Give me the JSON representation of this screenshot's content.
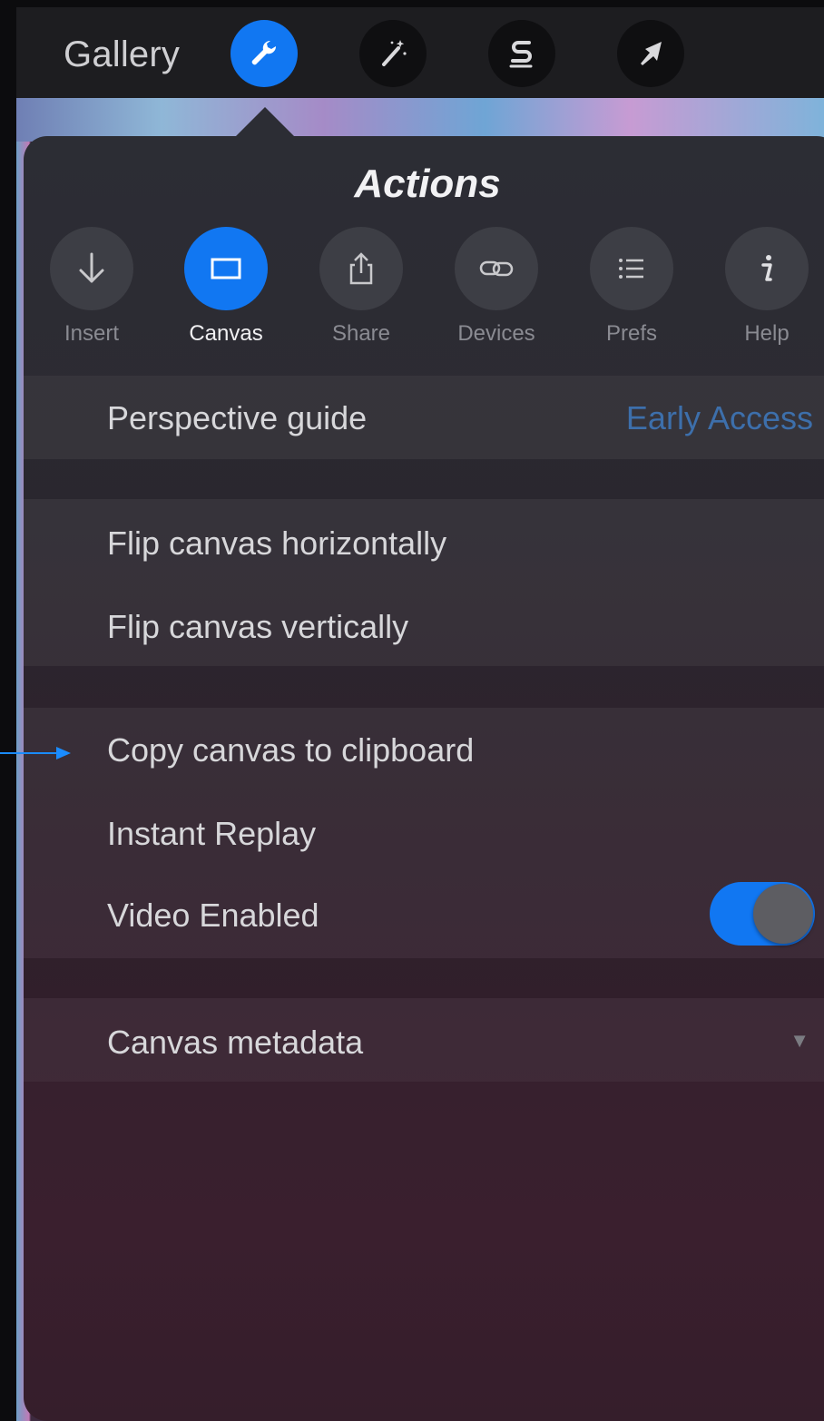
{
  "toolbar": {
    "gallery_label": "Gallery",
    "tools": [
      {
        "name": "actions-tool",
        "icon": "wrench-icon",
        "active": true
      },
      {
        "name": "adjustments-tool",
        "icon": "magic-wand-icon",
        "active": false
      },
      {
        "name": "selection-tool",
        "icon": "selection-s-icon",
        "active": false
      },
      {
        "name": "transform-tool",
        "icon": "arrow-cursor-icon",
        "active": false
      }
    ]
  },
  "popover": {
    "title": "Actions",
    "tabs": [
      {
        "label": "Insert",
        "icon": "arrow-down-icon",
        "active": false
      },
      {
        "label": "Canvas",
        "icon": "canvas-rect-icon",
        "active": true
      },
      {
        "label": "Share",
        "icon": "share-icon",
        "active": false
      },
      {
        "label": "Devices",
        "icon": "link-icon",
        "active": false
      },
      {
        "label": "Prefs",
        "icon": "list-icon",
        "active": false
      },
      {
        "label": "Help",
        "icon": "info-icon",
        "active": false
      }
    ],
    "items": {
      "perspective_guide": "Perspective guide",
      "early_access": "Early Access",
      "flip_horizontal": "Flip canvas horizontally",
      "flip_vertical": "Flip canvas vertically",
      "copy_canvas": "Copy canvas to clipboard",
      "instant_replay": "Instant Replay",
      "video_enabled": "Video Enabled",
      "video_enabled_on": true,
      "canvas_metadata": "Canvas metadata"
    }
  },
  "colors": {
    "accent": "#1177f2",
    "early_access": "#3d6fab",
    "annotation_arrow": "#1a8cff"
  }
}
